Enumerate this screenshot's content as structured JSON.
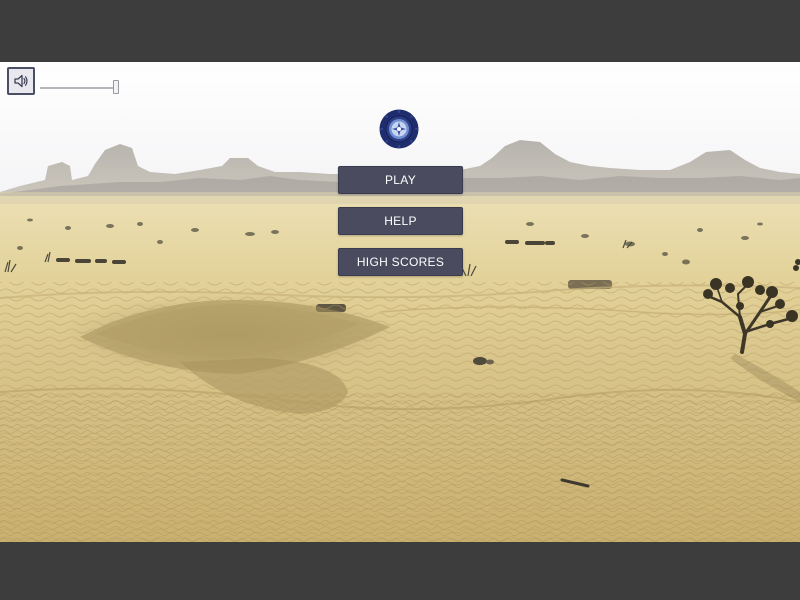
{
  "audio": {
    "sound_icon": "speaker-icon",
    "volume_level": 1.0
  },
  "emblem": {
    "icon": "compass-wheel-emblem"
  },
  "menu": {
    "items": [
      {
        "label": "PLAY"
      },
      {
        "label": "HELP"
      },
      {
        "label": "HIGH SCORES"
      }
    ]
  },
  "colors": {
    "letterbox": "#3d3d3d",
    "button_bg": "#4a4b5e",
    "button_text": "#ffffff",
    "sky": "#ffffff",
    "sand": "#d9c48a",
    "emblem": "#1f2d6e"
  }
}
